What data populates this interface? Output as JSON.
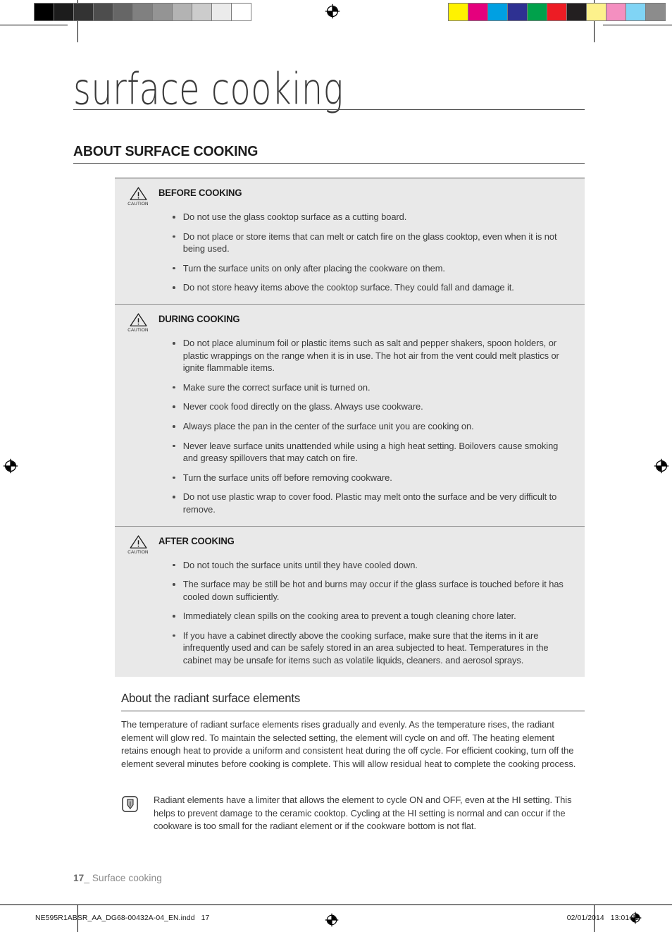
{
  "print_marks": {
    "grayscale_swatches": [
      "#000000",
      "#1c1c1c",
      "#333333",
      "#4d4d4d",
      "#666666",
      "#808080",
      "#949494",
      "#b3b3b3",
      "#cccccc",
      "#ebebeb",
      "#ffffff"
    ],
    "color_swatches": [
      "#fff200",
      "#e5007d",
      "#00a0e2",
      "#2e3192",
      "#00a14b",
      "#ed1c24",
      "#231f20",
      "#fdf18c",
      "#f48fc0",
      "#80d4f5",
      "#8c8c8c"
    ],
    "registration_icon": "registration-target-icon"
  },
  "header": {
    "chapter_title": "surface cooking",
    "section_title": "ABOUT SURFACE COOKING"
  },
  "caution": {
    "icon_name": "caution-triangle-icon",
    "icon_caption": "CAUTION",
    "blocks": [
      {
        "label": "BEFORE COOKING",
        "items": [
          "Do not use the glass cooktop surface as a cutting board.",
          "Do not place or store items that can melt or catch fire on the glass cooktop, even when it is not being used.",
          "Turn the surface units on only after placing the cookware on them.",
          "Do not store heavy items above the cooktop surface. They could fall and damage it."
        ]
      },
      {
        "label": "DURING COOKING",
        "items": [
          "Do not place aluminum foil or plastic items such as salt and pepper shakers, spoon holders, or plastic wrappings on the range when it is in use. The hot air from the vent could melt plastics or ignite flammable items.",
          "Make sure the correct surface unit is turned on.",
          "Never cook food directly on the glass. Always use cookware.",
          "Always place the pan in the center of the surface unit you are cooking on.",
          "Never leave surface units unattended while using a high heat setting. Boilovers cause smoking and greasy spillovers that may catch on fire.",
          "Turn the surface units off before removing cookware.",
          "Do not use plastic wrap to cover food. Plastic may melt onto the surface and be very difficult to remove."
        ]
      },
      {
        "label": "AFTER COOKING",
        "items": [
          "Do not touch the surface units until they have cooled down.",
          "The surface may be still be hot and burns may occur if the glass surface is touched before it has cooled down sufficiently.",
          "Immediately clean spills on the cooking area to prevent a tough cleaning chore later.",
          "If you have a cabinet directly above the cooking surface, make sure that the items in it are infrequently used and can be safely stored in an area subjected to heat. Temperatures in the cabinet may be unsafe for items such as volatile liquids, cleaners. and aerosol sprays."
        ]
      }
    ]
  },
  "radiant": {
    "sub_title": "About the radiant surface elements",
    "paragraph": "The temperature of radiant surface elements rises gradually and evenly. As the temperature rises, the radiant element will glow red. To maintain the selected setting, the element will cycle on and off. The heating element retains enough heat to provide a uniform and consistent heat during the off cycle. For efficient cooking, turn off the element several minutes before cooking is complete. This will allow residual heat to complete the cooking process.",
    "note_icon_name": "note-pencil-icon",
    "note_text": "Radiant elements have a limiter that allows the element to cycle ON and OFF, even at the HI setting. This helps to prevent damage to the ceramic cooktop. Cycling at the HI setting is normal and can occur if the cookware is too small for the radiant element or if the cookware bottom is not flat."
  },
  "footer": {
    "page_number": "17",
    "folio_separator": "_",
    "folio_label": "Surface cooking",
    "print_filename": "NE595R1ABSR_AA_DG68-00432A-04_EN.indd   17",
    "print_timestamp": "02/01/2014   13:01:42"
  }
}
